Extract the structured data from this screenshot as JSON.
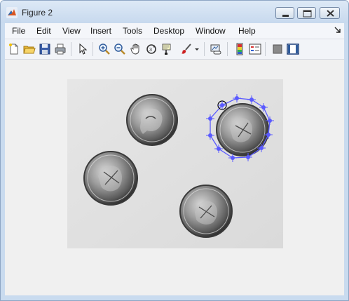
{
  "window": {
    "title": "Figure 2"
  },
  "menu": {
    "items": [
      "File",
      "Edit",
      "View",
      "Insert",
      "Tools",
      "Desktop",
      "Window",
      "Help"
    ]
  },
  "toolbar": {
    "buttons": [
      "new-figure",
      "open-file",
      "save-figure",
      "print-figure",
      "edit-plot",
      "zoom-in",
      "zoom-out",
      "pan",
      "rotate-3d",
      "data-cursor",
      "brush",
      "link-plot",
      "insert-colorbar",
      "insert-legend",
      "hide-plot-tools",
      "show-plot-tools"
    ]
  },
  "image": {
    "content": "grayscale photo of four coins with a polygon selection outline around the top-right coin",
    "roi_color": "#5a5aff"
  }
}
